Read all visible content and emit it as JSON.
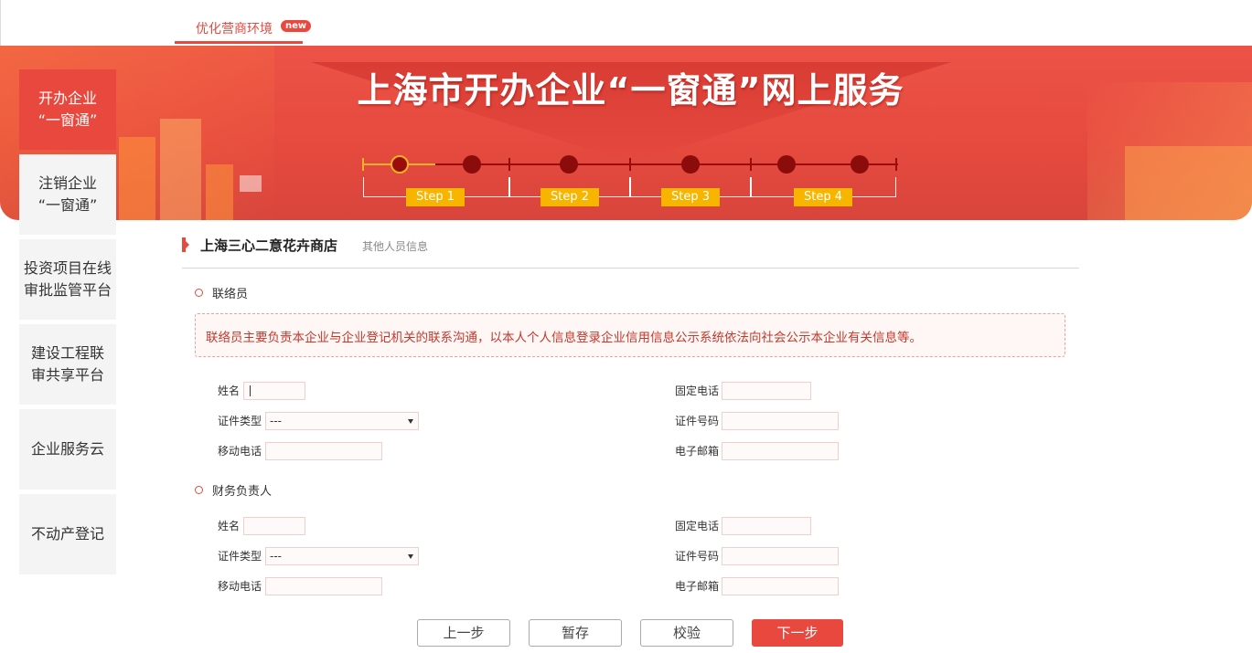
{
  "top_tab": {
    "label": "优化营商环境",
    "badge": "new"
  },
  "banner": {
    "title": "上海市开办企业“一窗通”网上服务"
  },
  "steps": [
    "Step 1",
    "Step 2",
    "Step 3",
    "Step 4"
  ],
  "sidebar": {
    "items": [
      {
        "label": "开办企业\n“一窗通”",
        "active": true
      },
      {
        "label": "注销企业\n“一窗通”",
        "active": false
      },
      {
        "label": "投资项目在线\n审批监管平台",
        "active": false
      },
      {
        "label": "建设工程联\n审共享平台",
        "active": false
      },
      {
        "label": "企业服务云",
        "active": false
      },
      {
        "label": "不动产登记",
        "active": false
      }
    ]
  },
  "company": {
    "name": "上海三心二意花卉商店",
    "subtitle": "其他人员信息"
  },
  "contact": {
    "title": "联络员",
    "notice": "联络员主要负责本企业与企业登记机关的联系沟通，以本人个人信息登录企业信用信息公示系统依法向社会公示本企业有关信息等。",
    "name_label": "姓名",
    "name_value": "",
    "phone_label": "固定电话",
    "phone_value": "",
    "id_type_label": "证件类型",
    "id_type_value": "---",
    "id_no_label": "证件号码",
    "id_no_value": "",
    "mobile_label": "移动电话",
    "mobile_value": "",
    "email_label": "电子邮箱",
    "email_value": ""
  },
  "finance": {
    "title": "财务负责人",
    "name_label": "姓名",
    "name_value": "",
    "phone_label": "固定电话",
    "phone_value": "",
    "id_type_label": "证件类型",
    "id_type_value": "---",
    "id_no_label": "证件号码",
    "id_no_value": "",
    "mobile_label": "移动电话",
    "mobile_value": "",
    "email_label": "电子邮箱",
    "email_value": ""
  },
  "buttons": {
    "prev": "上一步",
    "save": "暂存",
    "validate": "校验",
    "next": "下一步"
  },
  "colors": {
    "accent": "#e8483e",
    "step_label": "#f7b500",
    "track": "#9b0d0d"
  }
}
